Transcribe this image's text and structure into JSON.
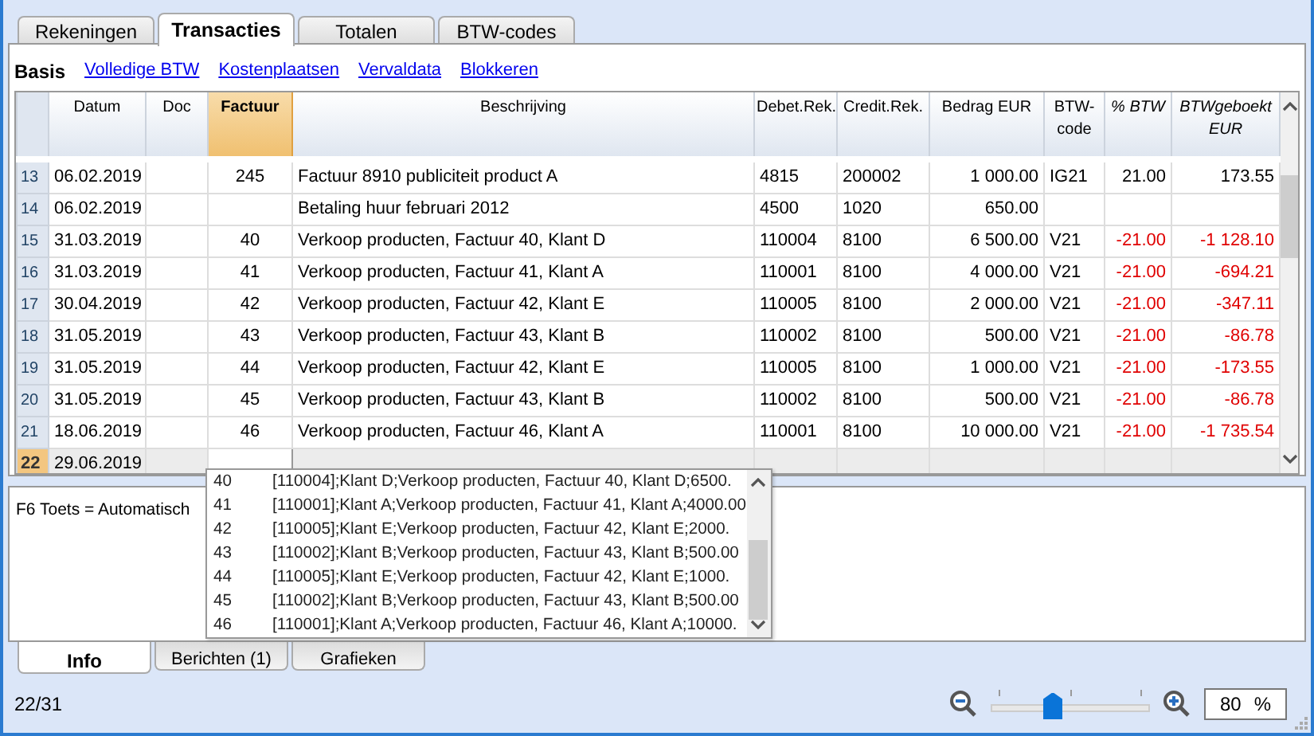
{
  "tabs": [
    {
      "label": "Rekeningen",
      "selected": false
    },
    {
      "label": "Transacties",
      "selected": true
    },
    {
      "label": "Totalen",
      "selected": false
    },
    {
      "label": "BTW-codes",
      "selected": false
    }
  ],
  "views": [
    {
      "label": "Basis",
      "selected": true
    },
    {
      "label": "Volledige BTW",
      "selected": false
    },
    {
      "label": "Kostenplaatsen",
      "selected": false
    },
    {
      "label": "Vervaldata",
      "selected": false
    },
    {
      "label": "Blokkeren",
      "selected": false
    }
  ],
  "table": {
    "columns": [
      {
        "label": "Datum",
        "selected": false,
        "italic": false
      },
      {
        "label": "Doc",
        "selected": false,
        "italic": false
      },
      {
        "label": "Factuur",
        "selected": true,
        "italic": false
      },
      {
        "label": "Beschrijving",
        "selected": false,
        "italic": false
      },
      {
        "label": "Debet.Rek.",
        "selected": false,
        "italic": false
      },
      {
        "label": "Credit.Rek.",
        "selected": false,
        "italic": false
      },
      {
        "label": "Bedrag EUR",
        "selected": false,
        "italic": false
      },
      {
        "label": "BTW-code",
        "selected": false,
        "italic": false
      },
      {
        "label": "% BTW",
        "selected": false,
        "italic": true
      },
      {
        "label": "BTWgeboekt EUR",
        "selected": false,
        "italic": true
      }
    ],
    "rows": [
      {
        "number": "13",
        "selected": false,
        "vat_negative": false,
        "date": "06.02.2019",
        "invoice": "245",
        "description": "Factuur 8910 publiciteit product A",
        "debit": "4815",
        "credit": "200002",
        "amount": "1 000.00",
        "vat_code": "IG21",
        "vat_pct": "21.00",
        "vat_booked": "173.55"
      },
      {
        "number": "14",
        "selected": false,
        "vat_negative": false,
        "date": "06.02.2019",
        "description": "Betaling huur februari 2012",
        "debit": "4500",
        "credit": "1020",
        "amount": "650.00"
      },
      {
        "number": "15",
        "selected": false,
        "vat_negative": true,
        "date": "31.03.2019",
        "invoice": "40",
        "description": "Verkoop producten, Factuur 40, Klant D",
        "debit": "110004",
        "credit": "8100",
        "amount": "6 500.00",
        "vat_code": "V21",
        "vat_pct": "-21.00",
        "vat_booked": "-1 128.10"
      },
      {
        "number": "16",
        "selected": false,
        "vat_negative": true,
        "date": "31.03.2019",
        "invoice": "41",
        "description": "Verkoop producten, Factuur 41, Klant A",
        "debit": "110001",
        "credit": "8100",
        "amount": "4 000.00",
        "vat_code": "V21",
        "vat_pct": "-21.00",
        "vat_booked": "-694.21"
      },
      {
        "number": "17",
        "selected": false,
        "vat_negative": true,
        "date": "30.04.2019",
        "invoice": "42",
        "description": "Verkoop producten, Factuur 42, Klant E",
        "debit": "110005",
        "credit": "8100",
        "amount": "2 000.00",
        "vat_code": "V21",
        "vat_pct": "-21.00",
        "vat_booked": "-347.11"
      },
      {
        "number": "18",
        "selected": false,
        "vat_negative": true,
        "date": "31.05.2019",
        "invoice": "43",
        "description": "Verkoop producten, Factuur 43, Klant B",
        "debit": "110002",
        "credit": "8100",
        "amount": "500.00",
        "vat_code": "V21",
        "vat_pct": "-21.00",
        "vat_booked": "-86.78"
      },
      {
        "number": "19",
        "selected": false,
        "vat_negative": true,
        "date": "31.05.2019",
        "invoice": "44",
        "description": "Verkoop producten, Factuur 42, Klant E",
        "debit": "110005",
        "credit": "8100",
        "amount": "1 000.00",
        "vat_code": "V21",
        "vat_pct": "-21.00",
        "vat_booked": "-173.55"
      },
      {
        "number": "20",
        "selected": false,
        "vat_negative": true,
        "date": "31.05.2019",
        "invoice": "45",
        "description": "Verkoop producten, Factuur 43, Klant B",
        "debit": "110002",
        "credit": "8100",
        "amount": "500.00",
        "vat_code": "V21",
        "vat_pct": "-21.00",
        "vat_booked": "-86.78"
      },
      {
        "number": "21",
        "selected": false,
        "vat_negative": true,
        "date": "18.06.2019",
        "invoice": "46",
        "description": "Verkoop producten, Factuur 46, Klant A",
        "debit": "110001",
        "credit": "8100",
        "amount": "10 000.00",
        "vat_code": "V21",
        "vat_pct": "-21.00",
        "vat_booked": "-1 735.54"
      },
      {
        "number": "22",
        "selected": true,
        "vat_negative": false,
        "date": "29.06.2019"
      }
    ]
  },
  "suggestions": [
    {
      "number": "40",
      "text": "[110004];Klant D;Verkoop producten, Factuur 40, Klant D;6500."
    },
    {
      "number": "41",
      "text": "[110001];Klant A;Verkoop producten, Factuur 41, Klant A;4000.00"
    },
    {
      "number": "42",
      "text": "[110005];Klant E;Verkoop producten, Factuur 42, Klant E;2000."
    },
    {
      "number": "43",
      "text": "[110002];Klant B;Verkoop producten, Factuur 43, Klant B;500.00"
    },
    {
      "number": "44",
      "text": "[110005];Klant E;Verkoop producten, Factuur 42, Klant E;1000."
    },
    {
      "number": "45",
      "text": "[110002];Klant B;Verkoop producten, Factuur 43, Klant B;500.00"
    },
    {
      "number": "46",
      "text": "[110001];Klant A;Verkoop producten, Factuur 46, Klant A;10000."
    }
  ],
  "info_text": "F6 Toets = Automatisch",
  "bottom_tabs": [
    {
      "label": "Info",
      "selected": true
    },
    {
      "label": "Berichten (1)",
      "selected": false
    },
    {
      "label": "Grafieken",
      "selected": false
    }
  ],
  "status": "22/31",
  "zoom": {
    "level": 0.39,
    "value": "80",
    "unit": "%"
  }
}
